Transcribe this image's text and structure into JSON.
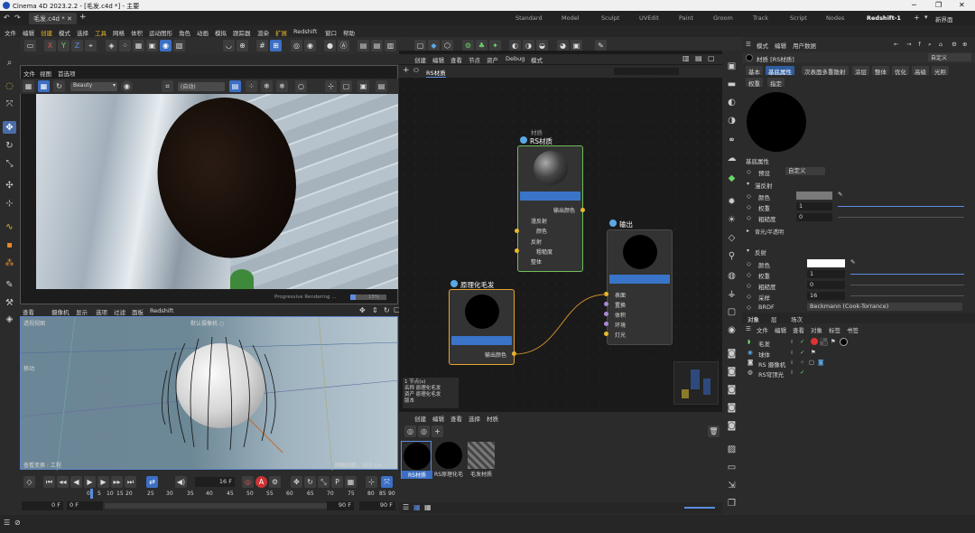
{
  "window": {
    "title": "Cinema 4D 2023.2.2 - [毛发.c4d *] - 主要",
    "minimize": "─",
    "restore": "❐",
    "close": "✕"
  },
  "doc_tab": "毛发.c4d *",
  "layout_tabs": [
    "Standard",
    "Model",
    "Sculpt",
    "UVEdit",
    "Paint",
    "Groom",
    "Track",
    "Script",
    "Nodes",
    "Redshift-1"
  ],
  "new_layout": "新界面",
  "menu": [
    "文件",
    "编辑",
    "创建",
    "模式",
    "选择",
    "工具",
    "网格",
    "体积",
    "运动图形",
    "角色",
    "动画",
    "模拟",
    "跟踪器",
    "渲染",
    "扩展",
    "Redshift",
    "窗口",
    "帮助"
  ],
  "toolbar_axes": [
    "X",
    "Y",
    "Z"
  ],
  "viewport1": {
    "menu": [
      "文件",
      "视图",
      "首选项"
    ],
    "beauty": "Beauty",
    "mode": "(自动)",
    "progress": "Progressive Rendering ...",
    "progress_pct": "15%"
  },
  "viewport2": {
    "menu": [
      "查看",
      "摄像机",
      "显示",
      "选项",
      "过滤",
      "面板",
      "Redshift"
    ],
    "label": "透视视图",
    "default_cam": "默认摄像机 ○",
    "move": "移动",
    "footer_left": "查看变换 : 工程",
    "grid": "网格间距 : 500 cm"
  },
  "timeline": {
    "frame_field": "16 F",
    "ticks": [
      "0",
      "5",
      "10",
      "15",
      "20",
      "25",
      "30",
      "35",
      "40",
      "45",
      "50",
      "55",
      "60",
      "65",
      "70",
      "75",
      "80",
      "85",
      "90"
    ],
    "start": "0 F",
    "start2": "0 F",
    "end": "90 F",
    "end2": "90 F"
  },
  "node_editor": {
    "menu": [
      "创建",
      "编辑",
      "查看",
      "节点",
      "资产",
      "Debug",
      "模式"
    ],
    "tab": "RS材质",
    "nodes": {
      "rs_material": {
        "title": "RS材质",
        "subtitle": "材质",
        "out": "输出颜色",
        "ports": [
          "漫反射",
          "颜色",
          "反射",
          "粗糙度",
          "整体"
        ]
      },
      "output": {
        "title": "输出",
        "ports": [
          "表面",
          "置换",
          "体积",
          "环境",
          "灯光"
        ]
      },
      "hair": {
        "title": "原理化毛发",
        "out": "输出颜色"
      }
    },
    "info": [
      "1 节点(s)",
      "名称",
      "资产",
      "版本"
    ],
    "info_vals": [
      "原理化毛发",
      "原理化毛发"
    ]
  },
  "material_manager": {
    "menu": [
      "创建",
      "编辑",
      "查看",
      "选择",
      "材质"
    ],
    "materials": [
      "RS材质",
      "RS原理化毛",
      "毛发材质"
    ]
  },
  "attributes": {
    "menu": [
      "模式",
      "编辑",
      "用户数据"
    ],
    "title": "材质 [RS材质]",
    "preset_top": "自定义",
    "tabs": [
      "基本",
      "基底属性",
      "次表面多重散射",
      "涂层",
      "整体",
      "优化",
      "高级",
      "光照"
    ],
    "subtabs": [
      "权重",
      "指定"
    ],
    "section": "基底属性",
    "preset_label": "预设",
    "preset_val": "自定义",
    "diffuse": {
      "title": "漫反射",
      "color": "颜色",
      "weight": "权重",
      "weight_val": "1",
      "rough": "粗糙度",
      "rough_val": "0"
    },
    "backlight": "背光/半透明",
    "reflection": {
      "title": "反射",
      "color": "颜色",
      "weight": "权重",
      "weight_val": "1",
      "rough": "粗糙度",
      "rough_val": "0",
      "samples": "采样",
      "samples_val": "16",
      "brdf": "BRDF",
      "brdf_val": "Beckmann (Cook-Torrance)"
    }
  },
  "objects": {
    "tabs": [
      "对象",
      "层",
      "场次"
    ],
    "menu": [
      "文件",
      "编辑",
      "查看",
      "对象",
      "标签",
      "书签"
    ],
    "items": [
      {
        "name": "毛发"
      },
      {
        "name": "球体"
      },
      {
        "name": "RS 摄像机"
      },
      {
        "name": "RS穹顶光"
      }
    ]
  },
  "colors": {
    "accent": "#3c6fc4",
    "node_bar": "#3a74c9",
    "port": "#e6b92e",
    "wire": "#c98a2a"
  }
}
